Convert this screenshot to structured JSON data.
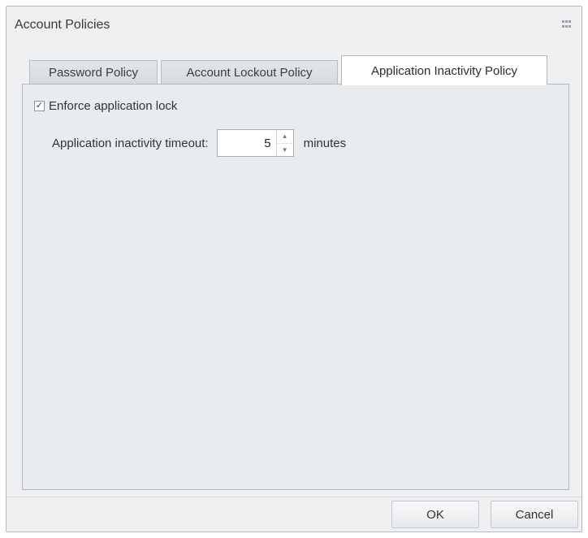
{
  "window": {
    "title": "Account Policies",
    "icon": "grip-icon"
  },
  "tabs": [
    {
      "label": "Password Policy",
      "active": false
    },
    {
      "label": "Account Lockout Policy",
      "active": false
    },
    {
      "label": "Application Inactivity Policy",
      "active": true
    }
  ],
  "panel": {
    "enforce_lock": {
      "label": "Enforce application lock",
      "checked": true,
      "check_glyph": "✓"
    },
    "timeout": {
      "label": "Application inactivity timeout:",
      "value": "5",
      "units": "minutes",
      "up_glyph": "▲",
      "down_glyph": "▼"
    }
  },
  "buttons": {
    "ok": "OK",
    "cancel": "Cancel"
  }
}
